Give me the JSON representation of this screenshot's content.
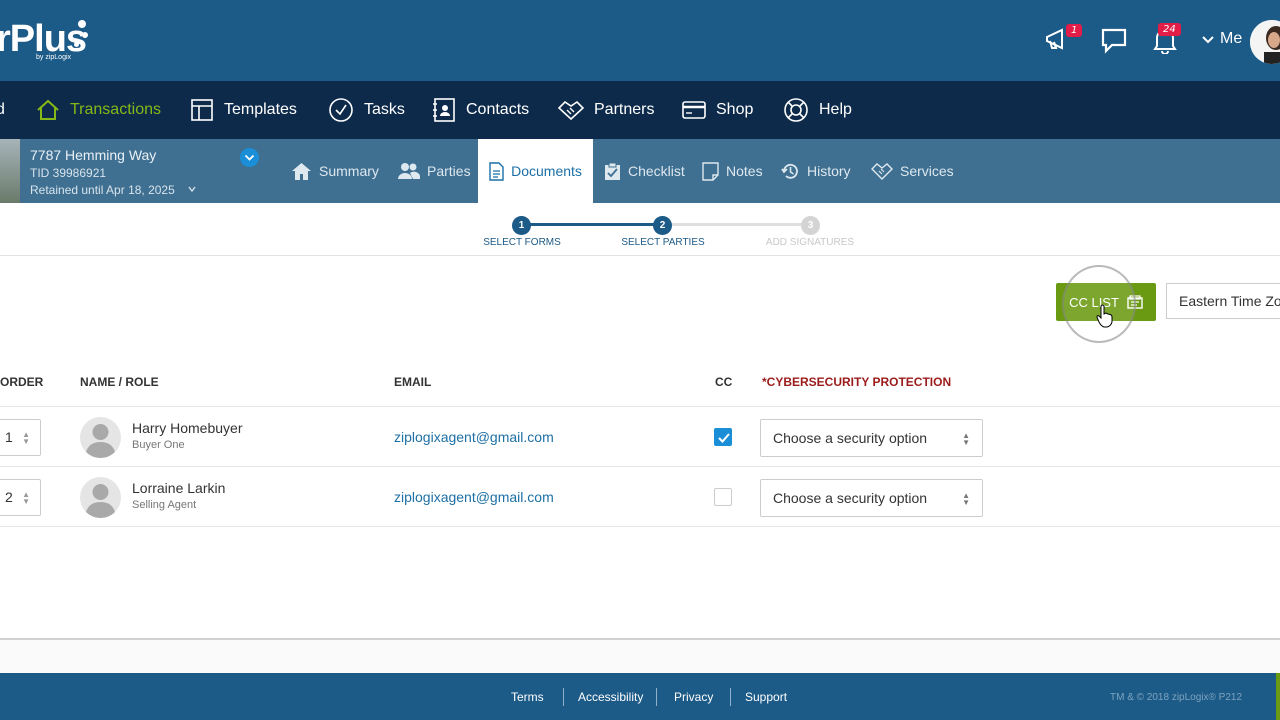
{
  "header": {
    "logo_text": "rPlus",
    "logo_sub": "by zipLogix",
    "announcements_badge": "1",
    "notifications_badge": "24",
    "user_label": "Me"
  },
  "nav": {
    "items": [
      {
        "label": "Transactions",
        "icon": "home-icon",
        "active": true
      },
      {
        "label": "Templates",
        "icon": "template-icon"
      },
      {
        "label": "Tasks",
        "icon": "check-circle-icon"
      },
      {
        "label": "Contacts",
        "icon": "contacts-icon"
      },
      {
        "label": "Partners",
        "icon": "handshake-icon"
      },
      {
        "label": "Shop",
        "icon": "credit-card-icon"
      },
      {
        "label": "Help",
        "icon": "lifebuoy-icon"
      }
    ]
  },
  "transaction": {
    "address": "7787 Hemming Way",
    "tid": "TID 39986921",
    "retained": "Retained until Apr 18, 2025"
  },
  "subnav": {
    "items": [
      {
        "label": "Summary",
        "icon": "home-icon"
      },
      {
        "label": "Parties",
        "icon": "people-icon"
      },
      {
        "label": "Documents",
        "icon": "document-icon",
        "active": true
      },
      {
        "label": "Checklist",
        "icon": "clipboard-icon"
      },
      {
        "label": "Notes",
        "icon": "note-icon"
      },
      {
        "label": "History",
        "icon": "history-icon"
      },
      {
        "label": "Services",
        "icon": "handshake-icon"
      }
    ]
  },
  "stepper": {
    "steps": [
      {
        "number": "1",
        "label": "SELECT FORMS",
        "state": "done"
      },
      {
        "number": "2",
        "label": "SELECT PARTIES",
        "state": "current"
      },
      {
        "number": "3",
        "label": "ADD SIGNATURES",
        "state": "upcoming"
      }
    ]
  },
  "controls": {
    "cc_list_label": "CC LIST",
    "timezone_value": "Eastern Time Zone"
  },
  "table": {
    "headers": {
      "order": "ORDER",
      "name_role": "NAME / ROLE",
      "email": "EMAIL",
      "cc": "CC",
      "security": "*CYBERSECURITY PROTECTION"
    },
    "rows": [
      {
        "order": "1",
        "name": "Harry Homebuyer",
        "role": "Buyer One",
        "email": "ziplogixagent@gmail.com",
        "cc": true,
        "security": "Choose a security option"
      },
      {
        "order": "2",
        "name": "Lorraine Larkin",
        "role": "Selling Agent",
        "email": "ziplogixagent@gmail.com",
        "cc": false,
        "security": "Choose a security option"
      }
    ]
  },
  "footer": {
    "links": [
      "Terms",
      "Accessibility",
      "Privacy",
      "Support"
    ],
    "copyright": "TM & © 2018 zipLogix® P212"
  },
  "colors": {
    "header_blue": "#1c5a87",
    "nav_dark": "#0d2a4a",
    "subnav_blue": "#3f6f91",
    "accent_green": "#6a9a12",
    "active_green": "#86b817",
    "link_blue": "#1d6fa5",
    "badge_red": "#e11d48"
  }
}
